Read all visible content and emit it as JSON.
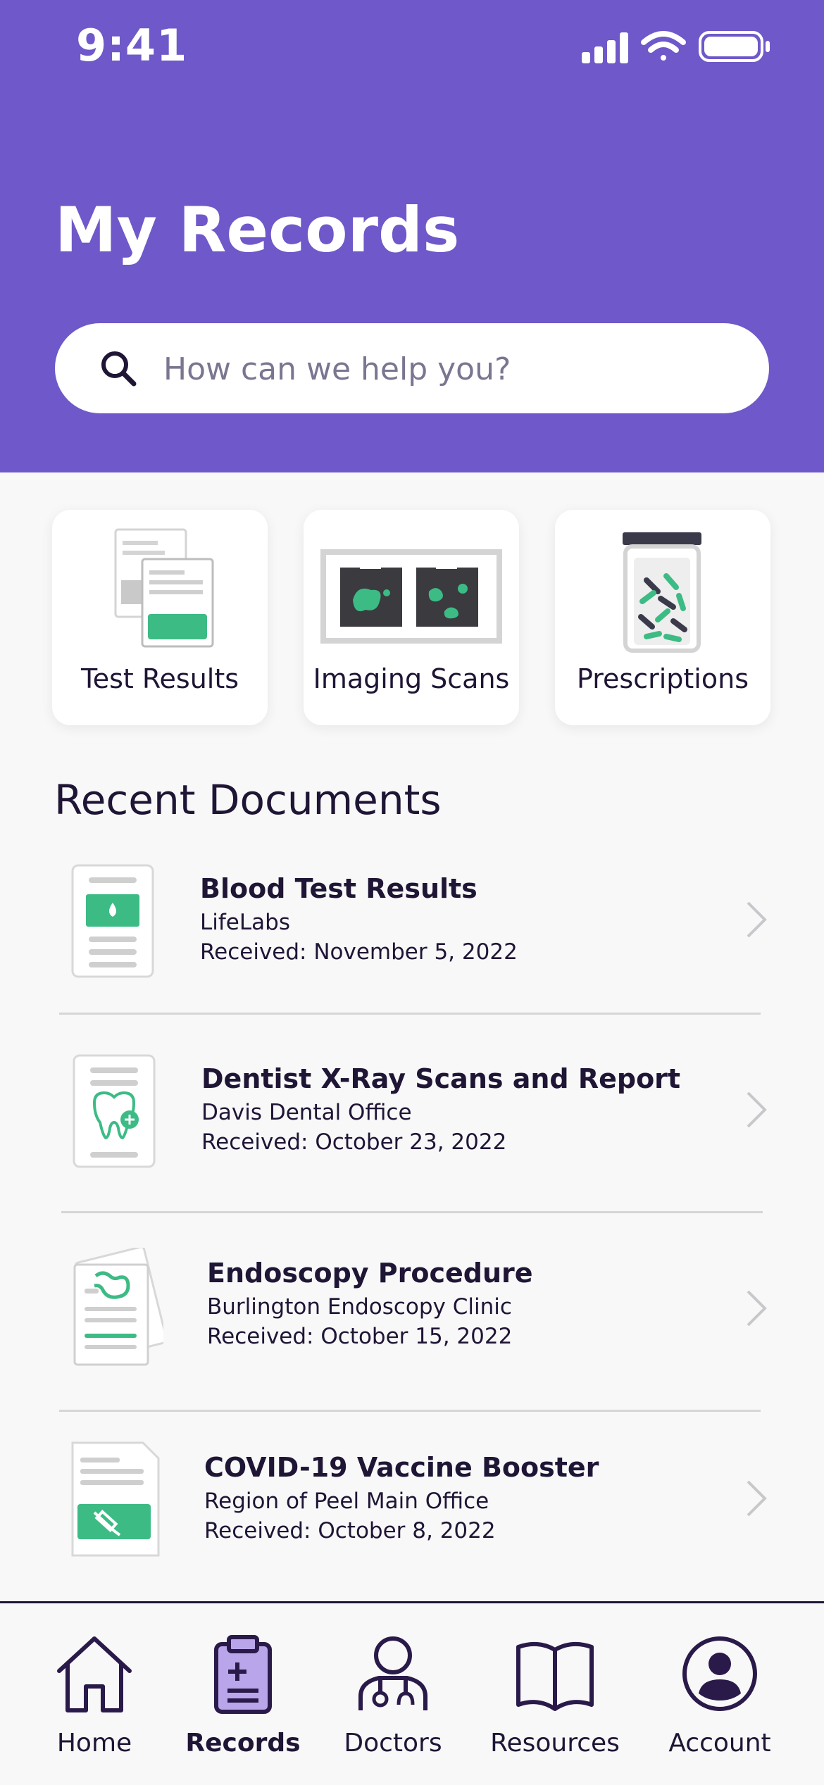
{
  "status_bar": {
    "time": "9:41"
  },
  "header": {
    "title": "My Records"
  },
  "search": {
    "placeholder": "How can we help you?"
  },
  "categories": [
    {
      "label": "Test Results"
    },
    {
      "label": "Imaging Scans"
    },
    {
      "label": "Prescriptions"
    }
  ],
  "recent": {
    "title": "Recent Documents",
    "documents": [
      {
        "title": "Blood Test Results",
        "source": "LifeLabs",
        "received": "Received: November 5, 2022",
        "icon": "blood-test-document-icon"
      },
      {
        "title": "Dentist X-Ray Scans and Report",
        "source": "Davis Dental Office",
        "received": "Received: October 23, 2022",
        "icon": "dental-document-icon"
      },
      {
        "title": "Endoscopy Procedure",
        "source": "Burlington Endoscopy Clinic",
        "received": "Received: October 15, 2022",
        "icon": "endoscopy-document-icon"
      },
      {
        "title": "COVID-19 Vaccine Booster",
        "source": "Region of Peel Main Office",
        "received": "Received: October 8, 2022",
        "icon": "vaccine-document-icon"
      }
    ]
  },
  "tabbar": {
    "active": "Records",
    "tabs": [
      {
        "label": "Home",
        "icon": "home-icon"
      },
      {
        "label": "Records",
        "icon": "clipboard-icon"
      },
      {
        "label": "Doctors",
        "icon": "doctor-icon"
      },
      {
        "label": "Resources",
        "icon": "book-icon"
      },
      {
        "label": "Account",
        "icon": "account-icon"
      }
    ]
  },
  "colors": {
    "header": "#6f58c9",
    "accent_green": "#3dbb85",
    "text": "#1f1535",
    "background": "#f8f8f8"
  }
}
